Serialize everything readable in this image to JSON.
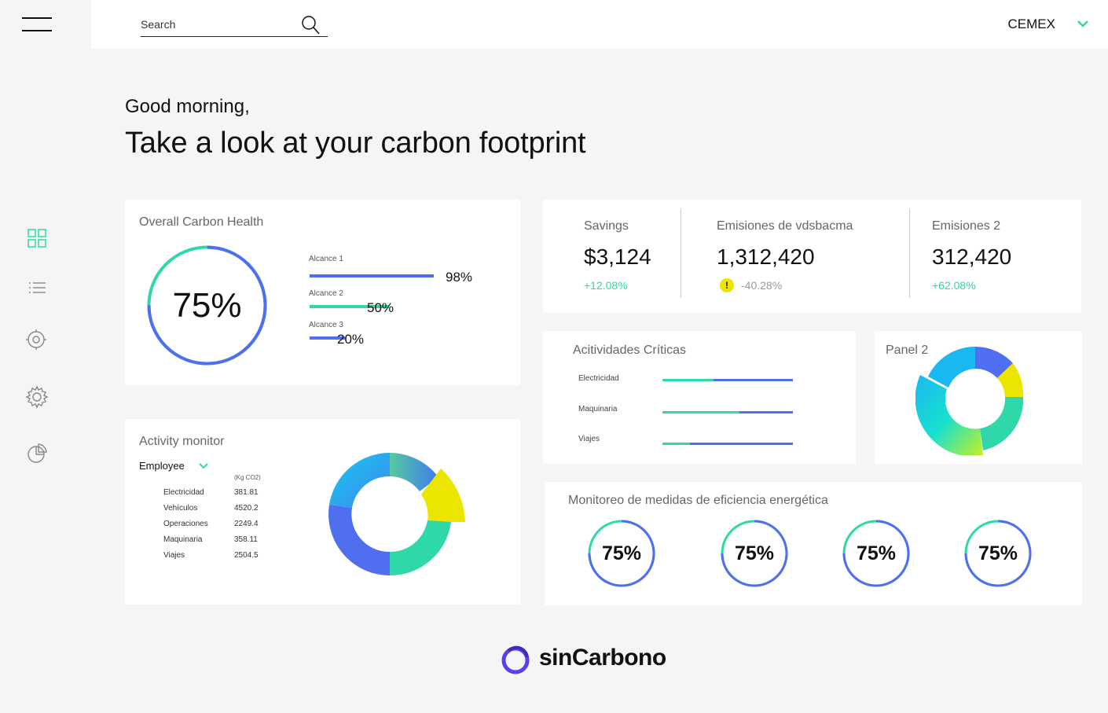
{
  "header": {
    "search_placeholder": "Search",
    "company": "CEMEX"
  },
  "greeting": {
    "line1": "Good morning,",
    "line2": "Take a look at your carbon footprint"
  },
  "sidebar": {
    "items": [
      {
        "icon": "grid-icon",
        "active": true
      },
      {
        "icon": "list-icon",
        "active": false
      },
      {
        "icon": "target-icon",
        "active": false
      },
      {
        "icon": "gear-icon",
        "active": false
      },
      {
        "icon": "pie-chart-icon",
        "active": false
      }
    ]
  },
  "overall": {
    "title": "Overall Carbon Health",
    "percent_label": "75%",
    "percent": 75,
    "scopes": [
      {
        "label": "Alcance 1",
        "value_label": "98%",
        "value": 98
      },
      {
        "label": "Alcance 2",
        "value_label": "50%",
        "value": 50
      },
      {
        "label": "Alcance 3",
        "value_label": "20%",
        "value": 20
      }
    ]
  },
  "stats": [
    {
      "label": "Savings",
      "value": "$3,124",
      "delta": "+12.08%",
      "trend": "up"
    },
    {
      "label": "Emisiones de vdsbacma",
      "value": "1,312,420",
      "delta": "-40.28%",
      "trend": "down",
      "warning": "!"
    },
    {
      "label": "Emisiones 2",
      "value": "312,420",
      "delta": "+62.08%",
      "trend": "up"
    }
  ],
  "activity": {
    "title": "Activity monitor",
    "filter": "Employee",
    "unit": "(Kg CO2)",
    "rows": [
      {
        "label": "Electricidad",
        "value": "381.81"
      },
      {
        "label": "Vehículos",
        "value": "4520.2"
      },
      {
        "label": "Operaciones",
        "value": "2249.4"
      },
      {
        "label": "Maquinaria",
        "value": "358.11"
      },
      {
        "label": "Viajes",
        "value": "2504.5"
      }
    ]
  },
  "criticas": {
    "title": "Acitividades Críticas",
    "rows": [
      {
        "label": "Electricidad",
        "fraction": 0.39
      },
      {
        "label": "Maquinaria",
        "fraction": 0.59
      },
      {
        "label": "Viajes",
        "fraction": 0.21
      }
    ]
  },
  "panel2": {
    "title": "Panel 2"
  },
  "eficiencia": {
    "title": "Monitoreo de medidas de eficiencia energética",
    "items": [
      {
        "label": "75%",
        "value": 75
      },
      {
        "label": "75%",
        "value": 75
      },
      {
        "label": "75%",
        "value": 75
      },
      {
        "label": "75%",
        "value": 75
      }
    ]
  },
  "brand": {
    "name": "sinCarbono"
  },
  "colors": {
    "accent_green": "#2ed8a8",
    "accent_blue": "#4f6ef0",
    "warning_yellow": "#ece500",
    "brand_purple": "#5b3ff0"
  }
}
